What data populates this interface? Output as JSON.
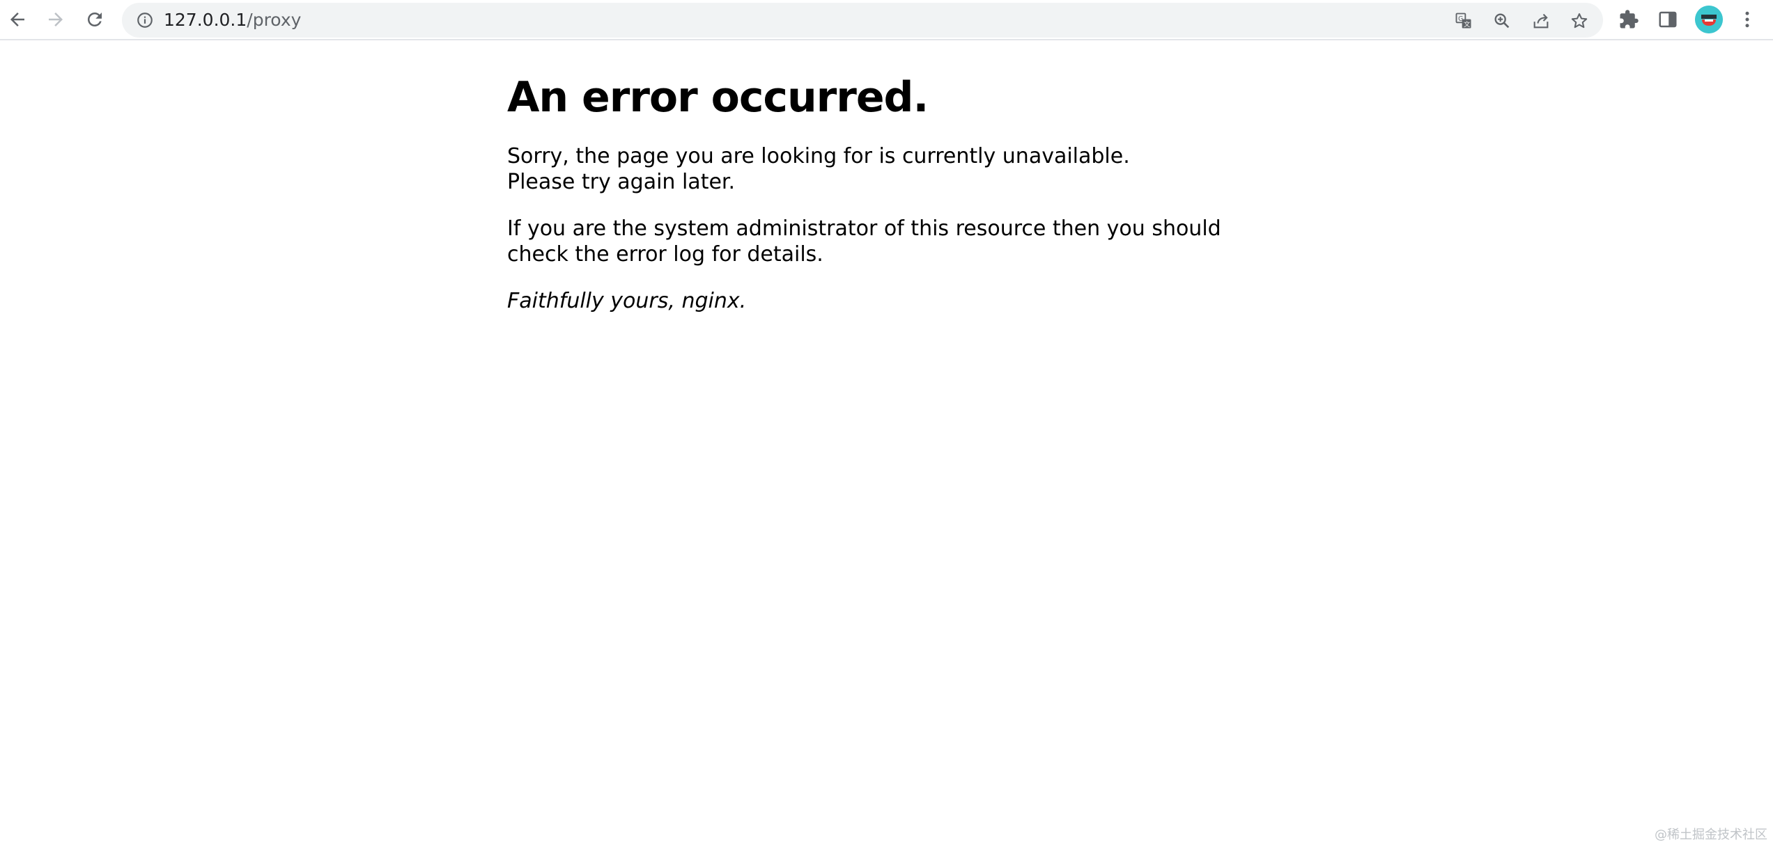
{
  "browser": {
    "url_host": "127.0.0.1",
    "url_path": "/proxy",
    "icons": {
      "back": "back-arrow-icon",
      "forward": "forward-arrow-icon",
      "reload": "reload-icon",
      "site_info": "info-icon",
      "translate": "translate-icon",
      "zoom": "zoom-in-icon",
      "share": "share-icon",
      "bookmark": "star-icon",
      "extensions": "puzzle-icon",
      "side_panel": "side-panel-icon",
      "menu": "kebab-menu-icon"
    },
    "accent_color": "#5f6368"
  },
  "page": {
    "title": "An error occurred.",
    "message_line1": "Sorry, the page you are looking for is currently unavailable.",
    "message_line2": "Please try again later.",
    "admin_note": "If you are the system administrator of this resource then you should check the error log for details.",
    "signature": "Faithfully yours, nginx."
  },
  "watermark": "@稀土掘金技术社区"
}
